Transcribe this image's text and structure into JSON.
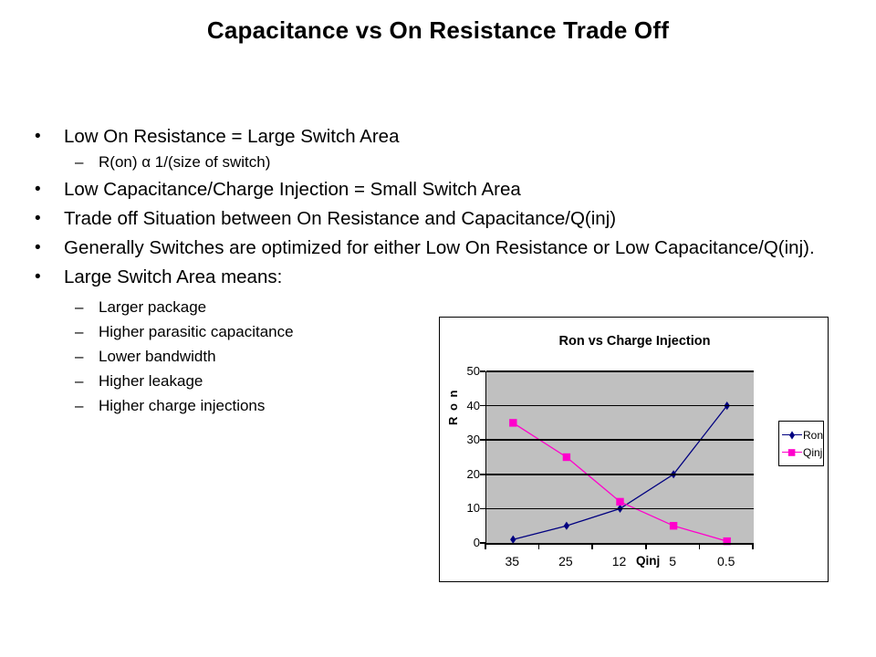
{
  "slide": {
    "title": "Capacitance vs On Resistance Trade Off",
    "bullets": [
      {
        "level": 1,
        "marker": "•",
        "text": "Low On Resistance = Large Switch Area"
      },
      {
        "level": 2,
        "marker": "–",
        "text": "R(on) α 1/(size of switch)"
      },
      {
        "level": 1,
        "marker": "•",
        "text": "Low Capacitance/Charge Injection = Small Switch Area"
      },
      {
        "level": 1,
        "marker": "•",
        "text": "Trade off Situation  between On Resistance and Capacitance/Q(inj)"
      },
      {
        "level": 1,
        "marker": "•",
        "text": "Generally Switches are optimized for either Low On Resistance or Low Capacitance/Q(inj)."
      },
      {
        "level": 1,
        "marker": "•",
        "text": "Large Switch Area means:"
      },
      {
        "level": 2,
        "marker": "–",
        "text": "Larger package"
      },
      {
        "level": 2,
        "marker": "–",
        "text": "Higher parasitic capacitance"
      },
      {
        "level": 2,
        "marker": "–",
        "text": "Lower bandwidth"
      },
      {
        "level": 2,
        "marker": "–",
        "text": "Higher leakage"
      },
      {
        "level": 2,
        "marker": "–",
        "text": "Higher charge injections"
      }
    ]
  },
  "chart_data": {
    "type": "line",
    "title": "Ron vs Charge Injection",
    "xlabel": "Qinj",
    "ylabel": "R o n",
    "categories": [
      "35",
      "25",
      "12",
      "5",
      "0.5"
    ],
    "series": [
      {
        "name": "Ron",
        "values": [
          1,
          5,
          10,
          20,
          40
        ],
        "color": "#000080",
        "marker": "diamond"
      },
      {
        "name": "Qinj",
        "values": [
          35,
          25,
          12,
          5,
          0.5
        ],
        "color": "#FF00CC",
        "marker": "square"
      }
    ],
    "ylim": [
      0,
      50
    ],
    "yticks": [
      "50",
      "40",
      "30",
      "20",
      "10",
      "0"
    ],
    "grid": true,
    "grid_color": "#000000",
    "plot_background": "#c0c0c0",
    "legend_position": "right",
    "legend_entries": [
      "Ron",
      "Qinj"
    ]
  }
}
